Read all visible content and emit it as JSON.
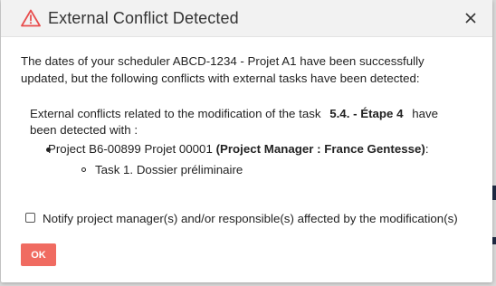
{
  "dialog": {
    "title": "External Conflict Detected",
    "icons": {
      "title_icon": "warning-triangle-icon",
      "close_icon": "close-icon"
    },
    "accent_color": "#e84d4d",
    "message": "The dates of your scheduler ABCD-1234 - Projet A1 have been successfully updated, but the following conflicts with external tasks have been detected:",
    "conflict_intro_before": "External conflicts related to the modification of the task",
    "conflict_task": "5.4. - Étape 4",
    "conflict_intro_after": "have been detected with :",
    "projects": [
      {
        "name": "Project B6-00899 Projet 00001",
        "manager": "(Project Manager : France Gentesse)",
        "suffix": ":",
        "tasks": [
          "Task 1. Dossier préliminaire"
        ]
      }
    ],
    "notify_label": "Notify project manager(s) and/or responsible(s) affected by the modification(s)",
    "notify_checked": false,
    "ok_label": "OK",
    "ok_color": "#f06b61"
  }
}
